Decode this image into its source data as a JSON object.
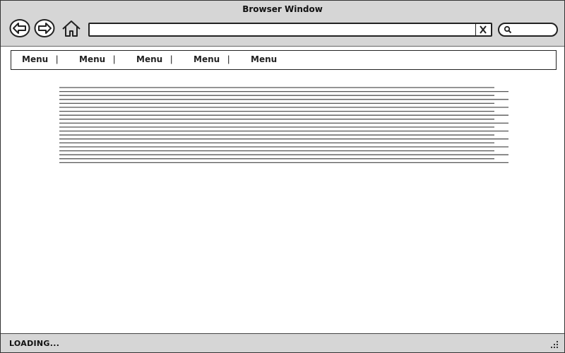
{
  "window": {
    "title": "Browser Window"
  },
  "toolbar": {
    "back_icon": "back-arrow-icon",
    "forward_icon": "forward-arrow-icon",
    "home_icon": "home-icon",
    "address_value": "",
    "clear_icon": "close-icon",
    "search_icon": "search-icon",
    "search_value": ""
  },
  "menubar": {
    "items": [
      {
        "label": "Menu"
      },
      {
        "label": "Menu"
      },
      {
        "label": "Menu"
      },
      {
        "label": "Menu"
      },
      {
        "label": "Menu"
      }
    ],
    "separator": "|"
  },
  "content": {
    "text_line_count": 20
  },
  "statusbar": {
    "status": "LOADING...",
    "grip_icon": "resize-grip-icon"
  },
  "colors": {
    "chrome_background": "#d6d6d6",
    "border": "#222222",
    "text_line": "#555555"
  }
}
